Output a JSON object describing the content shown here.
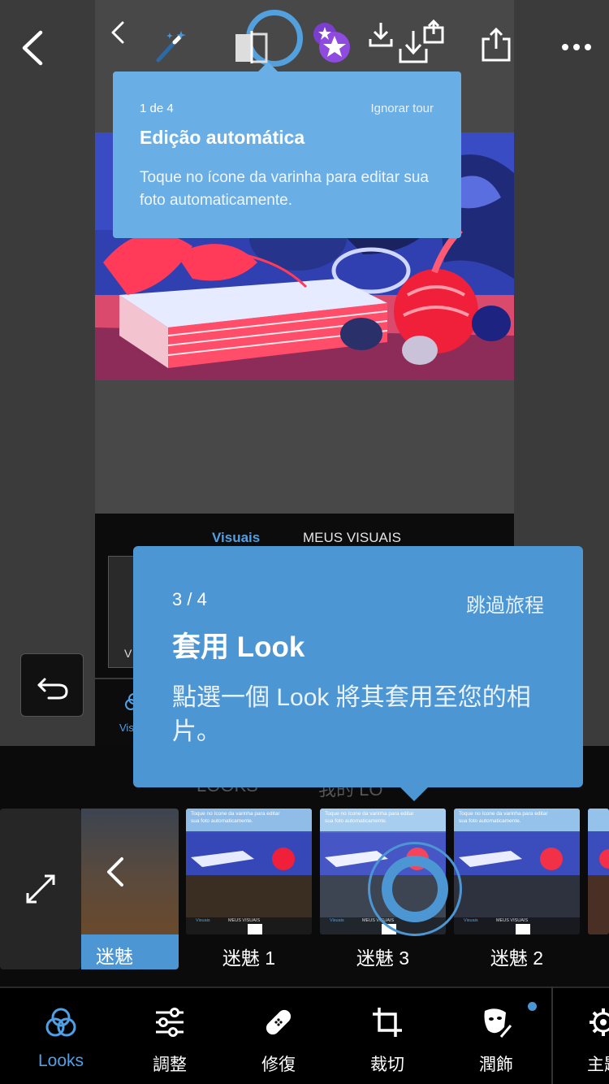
{
  "colors": {
    "accent": "#4c96d3",
    "tooltip_light": "#6aaee6",
    "active_text": "#4fa0e6"
  },
  "toolbar": {
    "back_icon": "chevron-left-icon",
    "more_icon": "more-horizontal-icon"
  },
  "inner_preview": {
    "tabs": [
      "Visuais",
      "MEUS VISUAIS"
    ],
    "thumb_text": "V",
    "bottom_label": "Vis"
  },
  "tooltip_small": {
    "step": "1 de 4",
    "skip": "Ignorar tour",
    "title": "Edição automática",
    "body": "Toque no ícone da varinha para editar sua foto automaticamente."
  },
  "tooltip_main": {
    "step": "3 / 4",
    "skip": "跳過旅程",
    "title": "套用 Look",
    "body": "點選一個 Look 將其套用至您的相片。"
  },
  "strip_headers": [
    "LOOKS",
    "我的 LO"
  ],
  "looks": {
    "previous_label": "迷魅",
    "items": [
      {
        "label": "迷魅 1"
      },
      {
        "label": "迷魅 3"
      },
      {
        "label": "迷魅 2"
      }
    ]
  },
  "thumb_caption": "Toque no ícone da varinha para editar sua foto automaticamente.",
  "thumb_tabs": [
    "Visuais",
    "MEUS VISUAIS"
  ],
  "nav": {
    "items": [
      {
        "label": "Looks",
        "icon": "looks-circles-icon"
      },
      {
        "label": "調整",
        "icon": "sliders-icon"
      },
      {
        "label": "修復",
        "icon": "bandage-icon"
      },
      {
        "label": "裁切",
        "icon": "crop-icon"
      },
      {
        "label": "潤飾",
        "icon": "retouch-face-icon"
      },
      {
        "label": "主題",
        "icon": "gear-icon"
      }
    ]
  }
}
